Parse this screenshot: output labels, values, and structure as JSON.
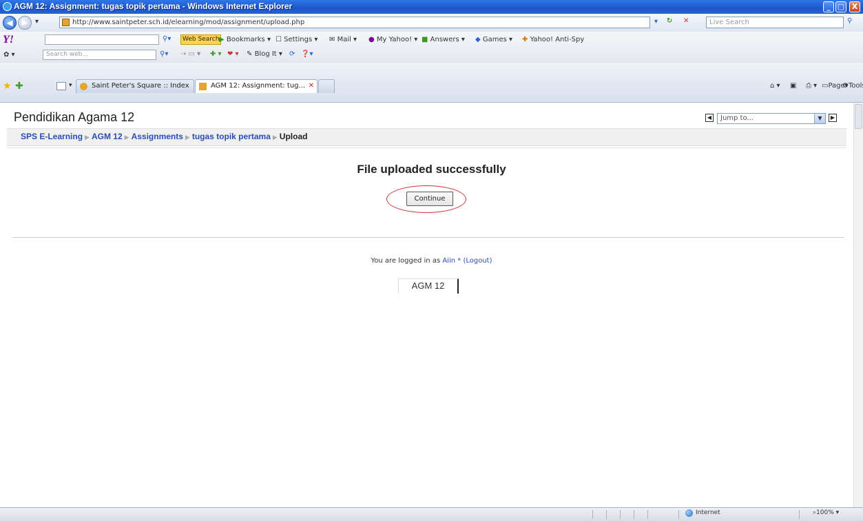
{
  "window": {
    "title": "AGM 12: Assignment: tugas topik pertama - Windows Internet Explorer",
    "minimize": "_",
    "maximize": "□",
    "close": "X"
  },
  "address_bar": {
    "url": "http://www.saintpeter.sch.id/elearning/mod/assignment/upload.php",
    "live_search_placeholder": "Live Search"
  },
  "yahoo_toolbar": {
    "logo": "Y!",
    "web_search": "Web Search",
    "bookmarks": "Bookmarks",
    "settings": "Settings",
    "mail": "Mail",
    "my_yahoo": "My Yahoo!",
    "answers": "Answers",
    "games": "Games",
    "anti_spy": "Yahoo! Anti-Spy",
    "search_web_placeholder": "Search web...",
    "blog_it": "Blog It"
  },
  "tabs": [
    {
      "label": "Saint Peter's Square :: Index"
    },
    {
      "label": "AGM 12: Assignment: tug..."
    }
  ],
  "command_bar": {
    "page": "Page",
    "tools": "Tools"
  },
  "page": {
    "course_title": "Pendidikan Agama 12",
    "breadcrumb": [
      {
        "label": "SPS E-Learning"
      },
      {
        "label": "AGM 12"
      },
      {
        "label": "Assignments"
      },
      {
        "label": "tugas topik pertama"
      }
    ],
    "breadcrumb_current": "Upload",
    "jump_to": "Jump to...",
    "message": "File uploaded successfully",
    "continue_label": "Continue",
    "logged_in_prefix": "You are logged in as",
    "user_name": "Aiin *",
    "logout_label": "(Logout)",
    "course_short": "AGM 12"
  },
  "status_bar": {
    "zone": "Internet",
    "zoom": "100%"
  },
  "colors": {
    "link": "#2a4db3",
    "highlight": "#d0323a",
    "titlebar": "#1b56c9"
  }
}
